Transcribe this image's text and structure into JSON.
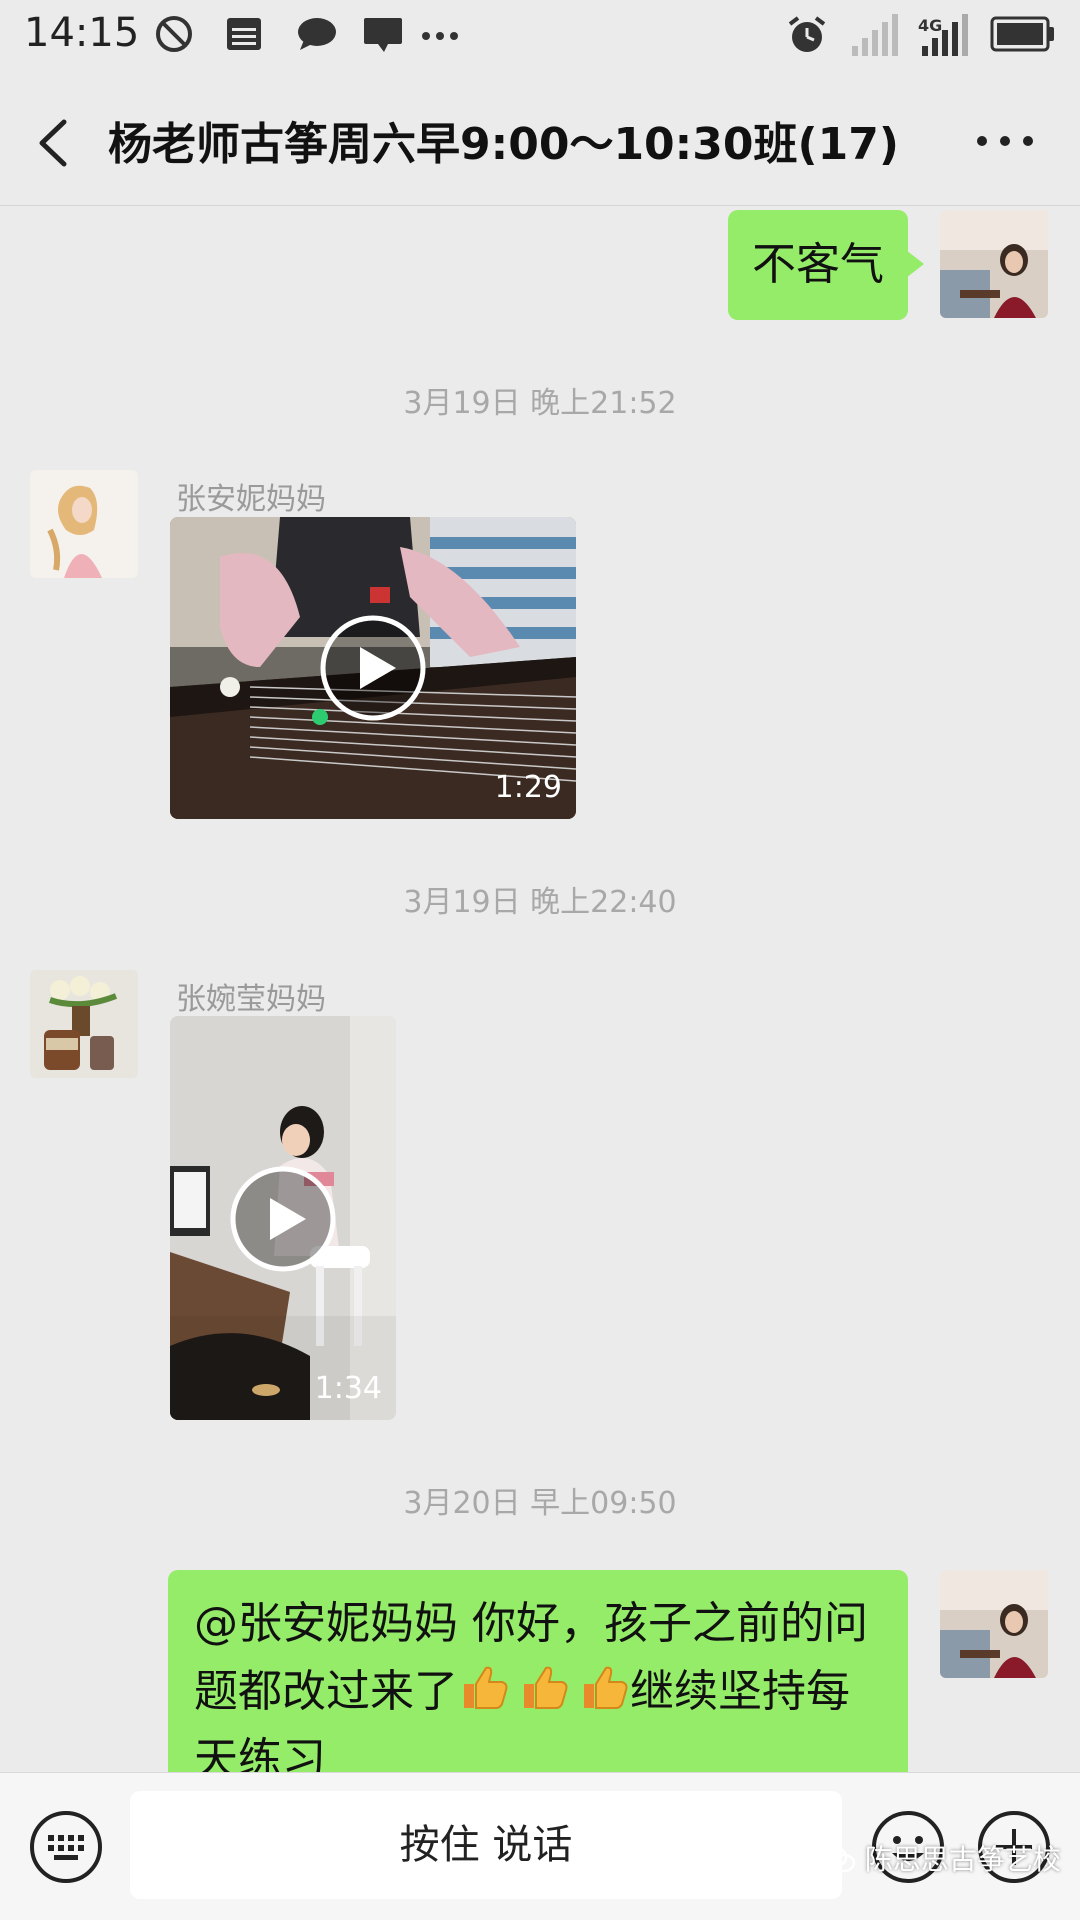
{
  "status_bar": {
    "time": "14:15",
    "network": "4G",
    "icons": [
      "do-not-disturb-icon",
      "news-icon",
      "chat-bubble-icon",
      "message-icon",
      "more-notifications-icon",
      "alarm-icon",
      "signal-weak-icon",
      "signal-4g-icon",
      "battery-icon"
    ]
  },
  "header": {
    "title": "杨老师古筝周六早9:00～10:30班(17)",
    "back_icon": "back-icon",
    "more_icon": "more-icon"
  },
  "messages": [
    {
      "type": "text",
      "direction": "outgoing",
      "text": "不客气"
    },
    {
      "type": "timestamp",
      "text": "3月19日 晚上21:52"
    },
    {
      "type": "video",
      "direction": "incoming",
      "sender": "张安妮妈妈",
      "duration": "1:29"
    },
    {
      "type": "timestamp",
      "text": "3月19日 晚上22:40"
    },
    {
      "type": "video",
      "direction": "incoming",
      "sender": "张婉莹妈妈",
      "duration": "1:34"
    },
    {
      "type": "timestamp",
      "text": "3月20日 早上09:50"
    },
    {
      "type": "text",
      "direction": "outgoing",
      "line1": "@张安妮妈妈  你好，孩子之前的问",
      "line2_a": "题都改过来了",
      "line2_b": "继续坚持每",
      "line3": "天练习"
    }
  ],
  "input_bar": {
    "voice_label": "按住 说话",
    "keyboard_icon": "keyboard-icon",
    "emoji_icon": "emoji-icon",
    "plus_icon": "plus-icon"
  },
  "watermark": "陈思思古筝艺校",
  "colors": {
    "bubble_green": "#95ec69",
    "background": "#ebebeb"
  }
}
